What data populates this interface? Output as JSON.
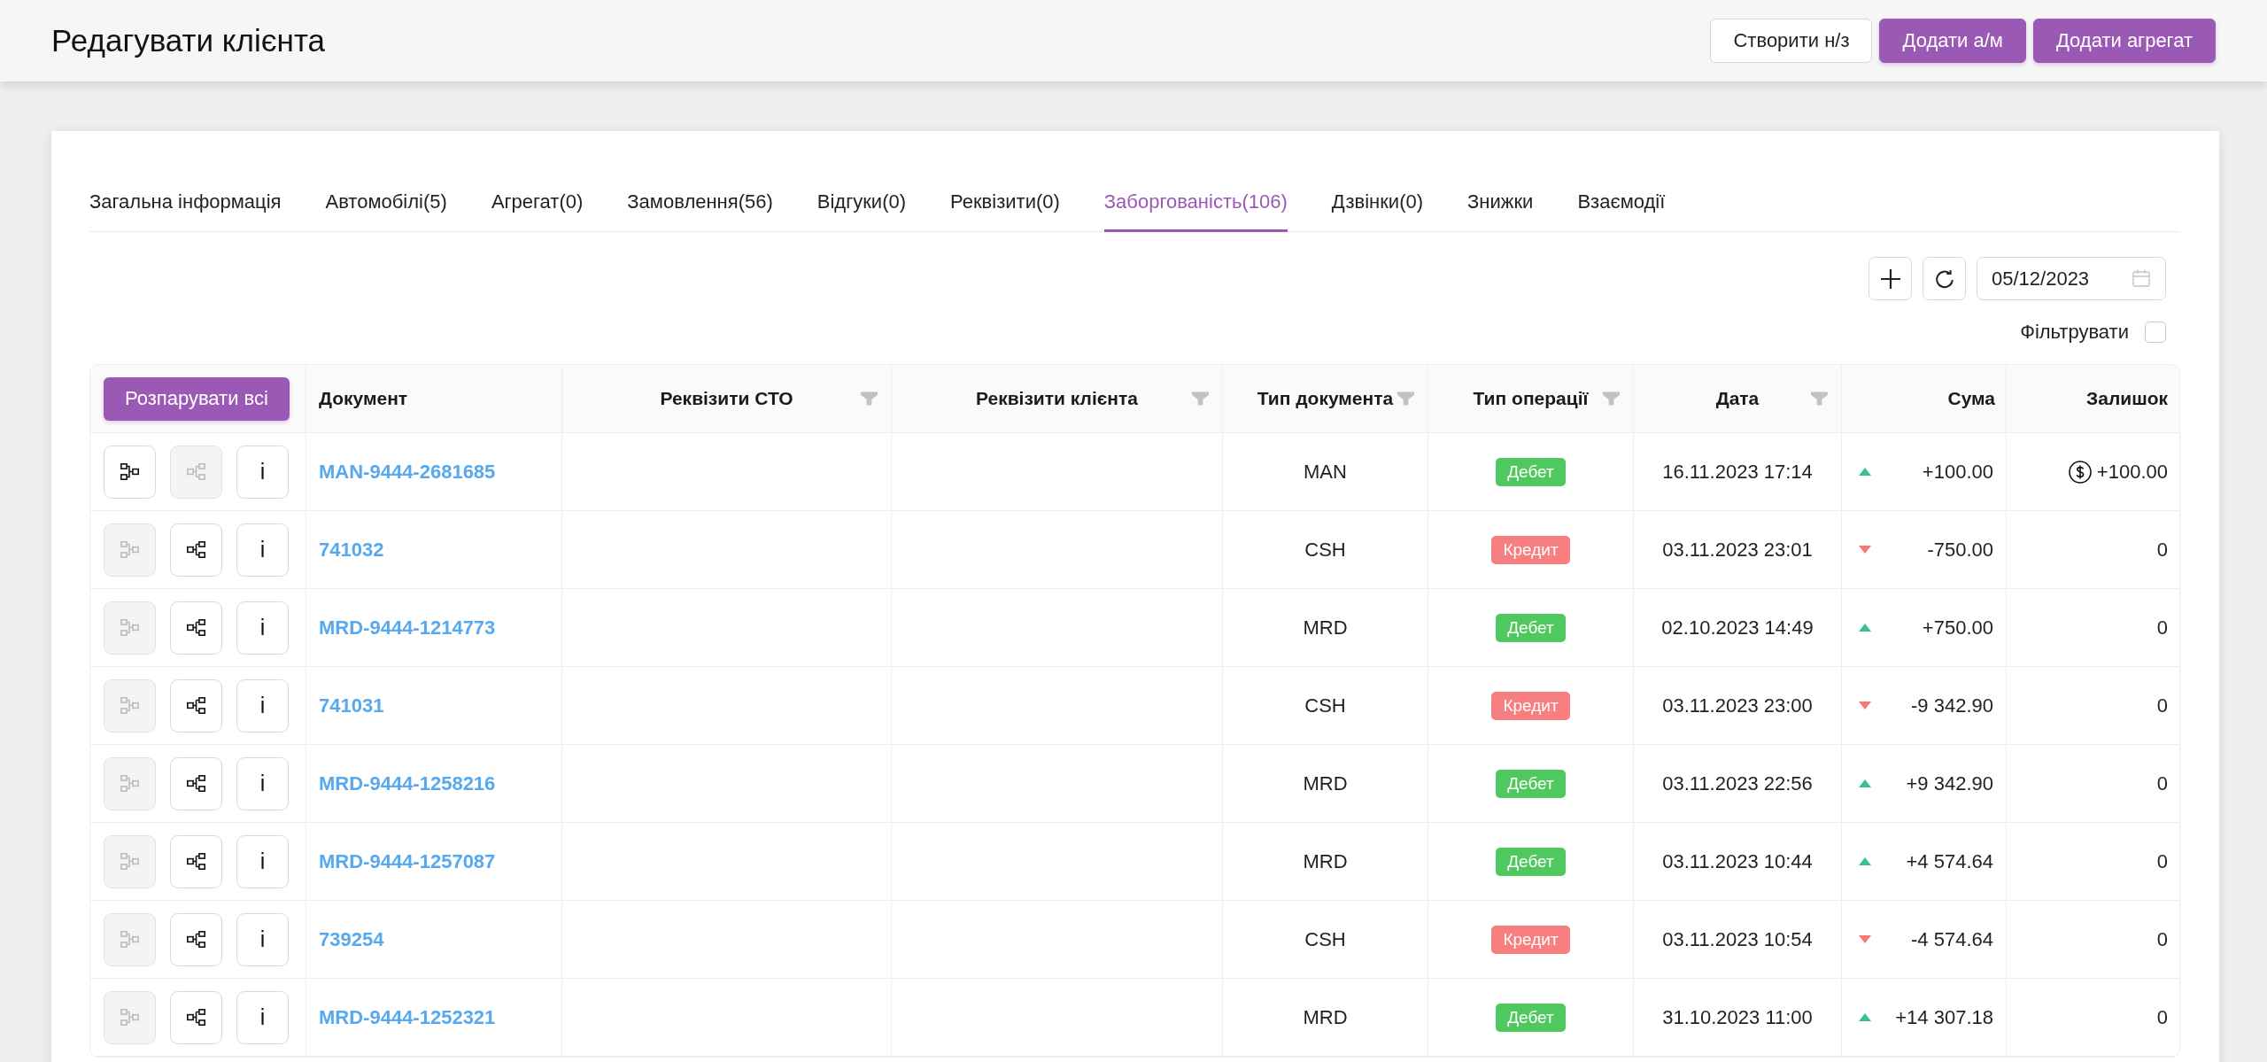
{
  "header": {
    "title": "Редагувати клієнта",
    "buttons": [
      {
        "label": "Створити н/з",
        "kind": "secondary"
      },
      {
        "label": "Додати а/м",
        "kind": "primary"
      },
      {
        "label": "Додати агрегат",
        "kind": "primary"
      }
    ]
  },
  "tabs": [
    {
      "label": "Загальна інформація",
      "selected": false
    },
    {
      "label": "Автомобілі(5)",
      "selected": false
    },
    {
      "label": "Агрегат(0)",
      "selected": false
    },
    {
      "label": "Замовлення(56)",
      "selected": false
    },
    {
      "label": "Відгуки(0)",
      "selected": false
    },
    {
      "label": "Реквізити(0)",
      "selected": false
    },
    {
      "label": "Заборгованість(106)",
      "selected": true
    },
    {
      "label": "Дзвінки(0)",
      "selected": false
    },
    {
      "label": "Знижки",
      "selected": false
    },
    {
      "label": "Взаємодії",
      "selected": false
    }
  ],
  "toolbar": {
    "date": "05/12/2023",
    "filter_label": "Фільтрувати",
    "filter_checked": false
  },
  "table": {
    "unpair_all_button": "Розпарувати всі",
    "columns": [
      {
        "label": "Документ",
        "filter": false
      },
      {
        "label": "Реквізити СТО",
        "filter": true
      },
      {
        "label": "Реквізити клієнта",
        "filter": true
      },
      {
        "label": "Тип документа",
        "filter": true
      },
      {
        "label": "Тип операції",
        "filter": true
      },
      {
        "label": "Дата",
        "filter": true
      },
      {
        "label": "Сума",
        "filter": false
      },
      {
        "label": "Залишок",
        "filter": false
      }
    ],
    "rows": [
      {
        "actions": [
          {
            "kind": "unpair",
            "disabled": false
          },
          {
            "kind": "pair",
            "disabled": true
          },
          {
            "kind": "info",
            "label": "i",
            "disabled": false
          }
        ],
        "document": "MAN-9444-2681685",
        "doc_type": "MAN",
        "operation": {
          "label": "Дебет",
          "kind": "debit"
        },
        "date": "16.11.2023 17:14",
        "rising": true,
        "amount": "+100.00",
        "balance": "+100.00",
        "balance_icon": true
      },
      {
        "actions": [
          {
            "kind": "unpair",
            "disabled": true
          },
          {
            "kind": "pair",
            "disabled": false
          },
          {
            "kind": "info",
            "label": "i",
            "disabled": false
          }
        ],
        "document": "741032",
        "doc_type": "CSH",
        "operation": {
          "label": "Кредит",
          "kind": "credit"
        },
        "date": "03.11.2023 23:01",
        "rising": false,
        "amount": "-750.00",
        "balance": "0",
        "balance_icon": false
      },
      {
        "actions": [
          {
            "kind": "unpair",
            "disabled": true
          },
          {
            "kind": "pair",
            "disabled": false
          },
          {
            "kind": "info",
            "label": "i",
            "disabled": false
          }
        ],
        "document": "MRD-9444-1214773",
        "doc_type": "MRD",
        "operation": {
          "label": "Дебет",
          "kind": "debit"
        },
        "date": "02.10.2023 14:49",
        "rising": true,
        "amount": "+750.00",
        "balance": "0",
        "balance_icon": false
      },
      {
        "actions": [
          {
            "kind": "unpair",
            "disabled": true
          },
          {
            "kind": "pair",
            "disabled": false
          },
          {
            "kind": "info",
            "label": "i",
            "disabled": false
          }
        ],
        "document": "741031",
        "doc_type": "CSH",
        "operation": {
          "label": "Кредит",
          "kind": "credit"
        },
        "date": "03.11.2023 23:00",
        "rising": false,
        "amount": "-9 342.90",
        "balance": "0",
        "balance_icon": false
      },
      {
        "actions": [
          {
            "kind": "unpair",
            "disabled": true
          },
          {
            "kind": "pair",
            "disabled": false
          },
          {
            "kind": "info",
            "label": "i",
            "disabled": false
          }
        ],
        "document": "MRD-9444-1258216",
        "doc_type": "MRD",
        "operation": {
          "label": "Дебет",
          "kind": "debit"
        },
        "date": "03.11.2023 22:56",
        "rising": true,
        "amount": "+9 342.90",
        "balance": "0",
        "balance_icon": false
      },
      {
        "actions": [
          {
            "kind": "unpair",
            "disabled": true
          },
          {
            "kind": "pair",
            "disabled": false
          },
          {
            "kind": "info",
            "label": "i",
            "disabled": false
          }
        ],
        "document": "MRD-9444-1257087",
        "doc_type": "MRD",
        "operation": {
          "label": "Дебет",
          "kind": "debit"
        },
        "date": "03.11.2023 10:44",
        "rising": true,
        "amount": "+4 574.64",
        "balance": "0",
        "balance_icon": false
      },
      {
        "actions": [
          {
            "kind": "unpair",
            "disabled": true
          },
          {
            "kind": "pair",
            "disabled": false
          },
          {
            "kind": "info",
            "label": "i",
            "disabled": false
          }
        ],
        "document": "739254",
        "doc_type": "CSH",
        "operation": {
          "label": "Кредит",
          "kind": "credit"
        },
        "date": "03.11.2023 10:54",
        "rising": false,
        "amount": "-4 574.64",
        "balance": "0",
        "balance_icon": false
      },
      {
        "actions": [
          {
            "kind": "unpair",
            "disabled": true
          },
          {
            "kind": "pair",
            "disabled": false
          },
          {
            "kind": "info",
            "label": "i",
            "disabled": false
          }
        ],
        "document": "MRD-9444-1252321",
        "doc_type": "MRD",
        "operation": {
          "label": "Дебет",
          "kind": "debit"
        },
        "date": "31.10.2023 11:00",
        "rising": true,
        "amount": "+14 307.18",
        "balance": "0",
        "balance_icon": false
      }
    ]
  }
}
